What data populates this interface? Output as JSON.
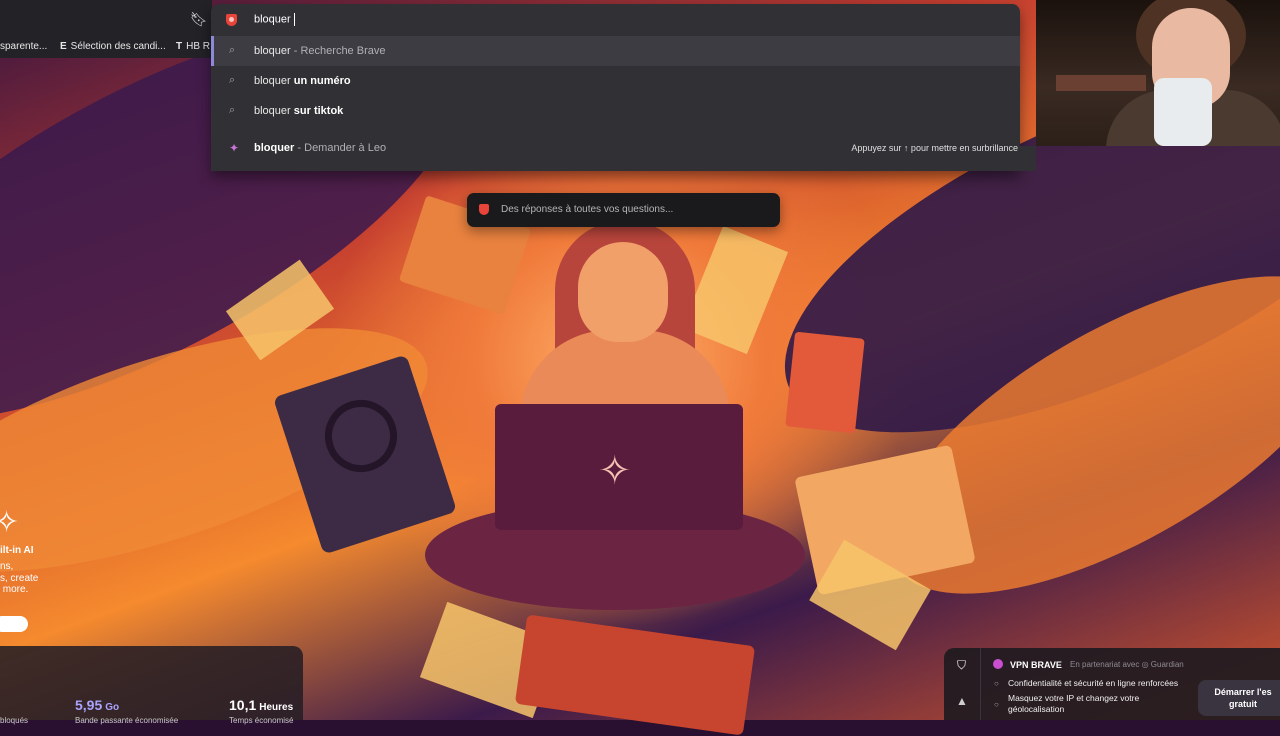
{
  "omnibox": {
    "input_value": "bloquer",
    "suggestions": [
      {
        "prefix": "bloquer",
        "bold": "",
        "suffix": " - Recherche Brave"
      },
      {
        "prefix": "bloquer ",
        "bold": "un numéro",
        "suffix": ""
      },
      {
        "prefix": "bloquer ",
        "bold": "sur tiktok",
        "suffix": ""
      }
    ],
    "leo": {
      "query": "bloquer",
      "action": " - Demander à Leo",
      "hint": "Appuyez sur ↑ pour mettre en surbrillance"
    },
    "search_icon": "search-icon",
    "accent": "#8c8ad6"
  },
  "bookmarks": [
    {
      "label": "sparente..."
    },
    {
      "icon": "E",
      "label": "Sélection des candi..."
    },
    {
      "icon": "T",
      "label": "HB R"
    }
  ],
  "ask_box": {
    "placeholder": "Des réponses à toutes vos questions..."
  },
  "promo": {
    "icon": "sparkle-icon",
    "title": "ilt-in AI",
    "text": "ns,\ns, create\n more.\n"
  },
  "stats": {
    "items": [
      {
        "value": "5,95",
        "unit": "Go",
        "sub": "Bande passante économisée",
        "color": "#a9a4ff"
      },
      {
        "value": "10,1",
        "unit": "Heures",
        "sub": "Temps économisé",
        "color": "#ffffff"
      }
    ],
    "left_sub": "bloqués"
  },
  "vpn": {
    "title": "VPN BRAVE",
    "partner": "En partenariat avec ◎ Guardian",
    "features": [
      "Confidentialité et sécurité en ligne renforcées",
      "Masquez votre IP et changez votre\ngéolocalisation"
    ],
    "cta": "Démarrer l'es\ngratuit"
  }
}
